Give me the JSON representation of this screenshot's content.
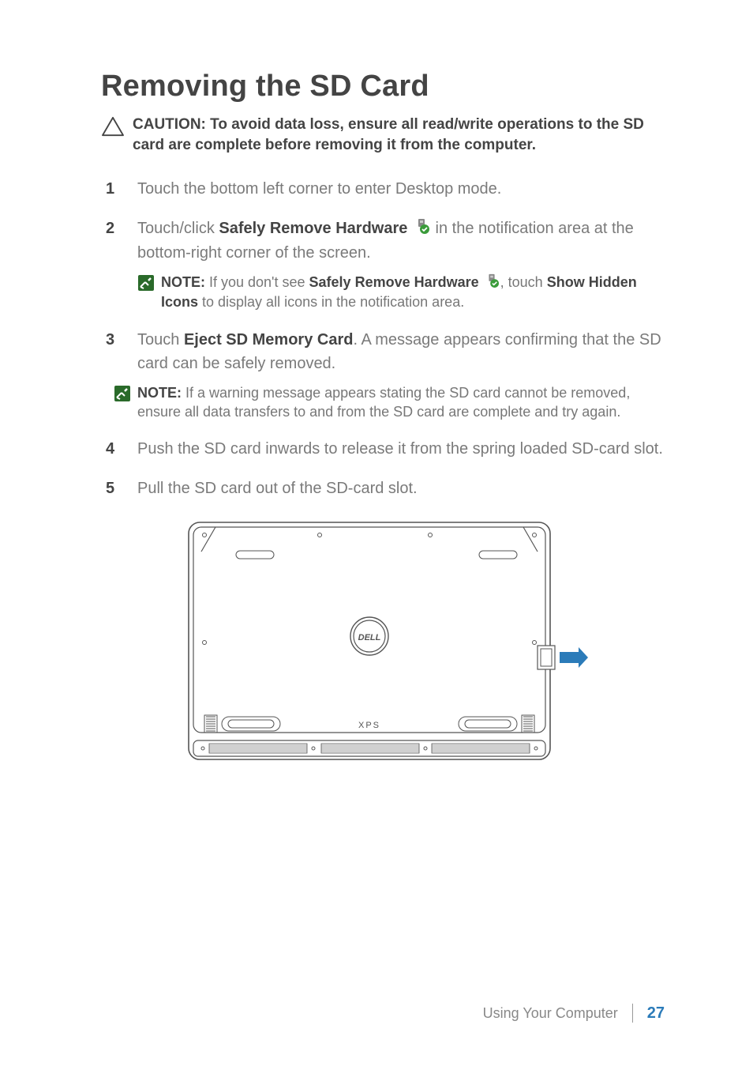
{
  "heading": "Removing the SD Card",
  "caution": "CAUTION: To avoid data loss, ensure all read/write operations to the SD card are complete before removing it from the computer.",
  "steps": {
    "s1": "Touch the bottom left corner to enter Desktop mode.",
    "s2_pre": "Touch/click ",
    "s2_bold": "Safely Remove Hardware",
    "s2_post": " in the notification area at the bottom-right corner of the screen.",
    "s2_note_label": "NOTE:",
    "s2_note_a": " If you don't see ",
    "s2_note_b": "Safely Remove Hardware",
    "s2_note_c": ", touch ",
    "s2_note_d": "Show Hidden Icons",
    "s2_note_e": " to display all icons in the notification area.",
    "s3_pre": "Touch ",
    "s3_bold": "Eject SD Memory Card",
    "s3_post": ". A message appears confirming that the SD card can be safely removed.",
    "s3_note_label": "NOTE:",
    "s3_note_body": " If a warning message appears stating the SD card cannot be removed, ensure all data transfers to and from the SD card are complete and try again.",
    "s4": "Push the SD card inwards to release it from the spring loaded SD-card slot.",
    "s5": "Pull the SD card out of the SD-card slot."
  },
  "diagram": {
    "logo": "DELL",
    "model": "XPS"
  },
  "footer": {
    "section": "Using Your Computer",
    "page": "27"
  }
}
